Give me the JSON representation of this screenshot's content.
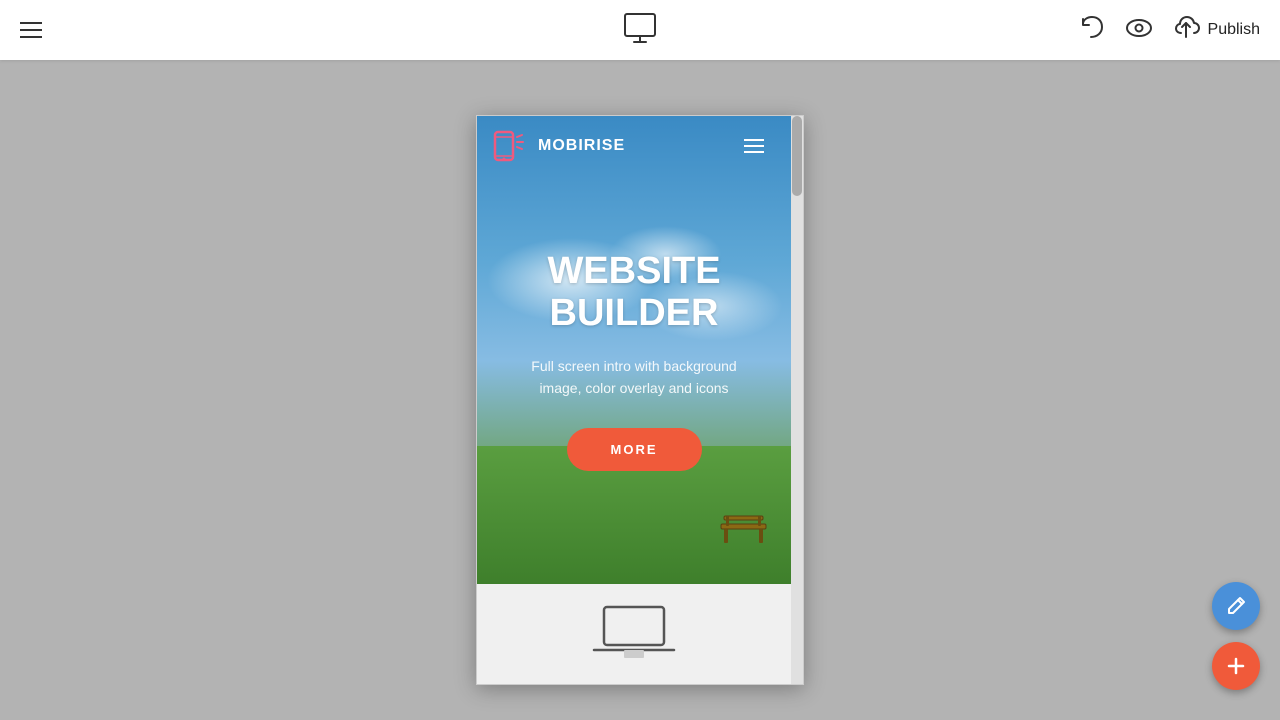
{
  "topbar": {
    "menu_label": "Menu",
    "publish_label": "Publish"
  },
  "preview": {
    "brand_name": "MOBIRISE",
    "hero_title_line1": "WEBSITE",
    "hero_title_line2": "BUILDER",
    "hero_subtitle": "Full screen intro with background image, color overlay and icons",
    "hero_cta": "MORE"
  },
  "fab": {
    "edit_label": "Edit",
    "add_label": "Add"
  }
}
